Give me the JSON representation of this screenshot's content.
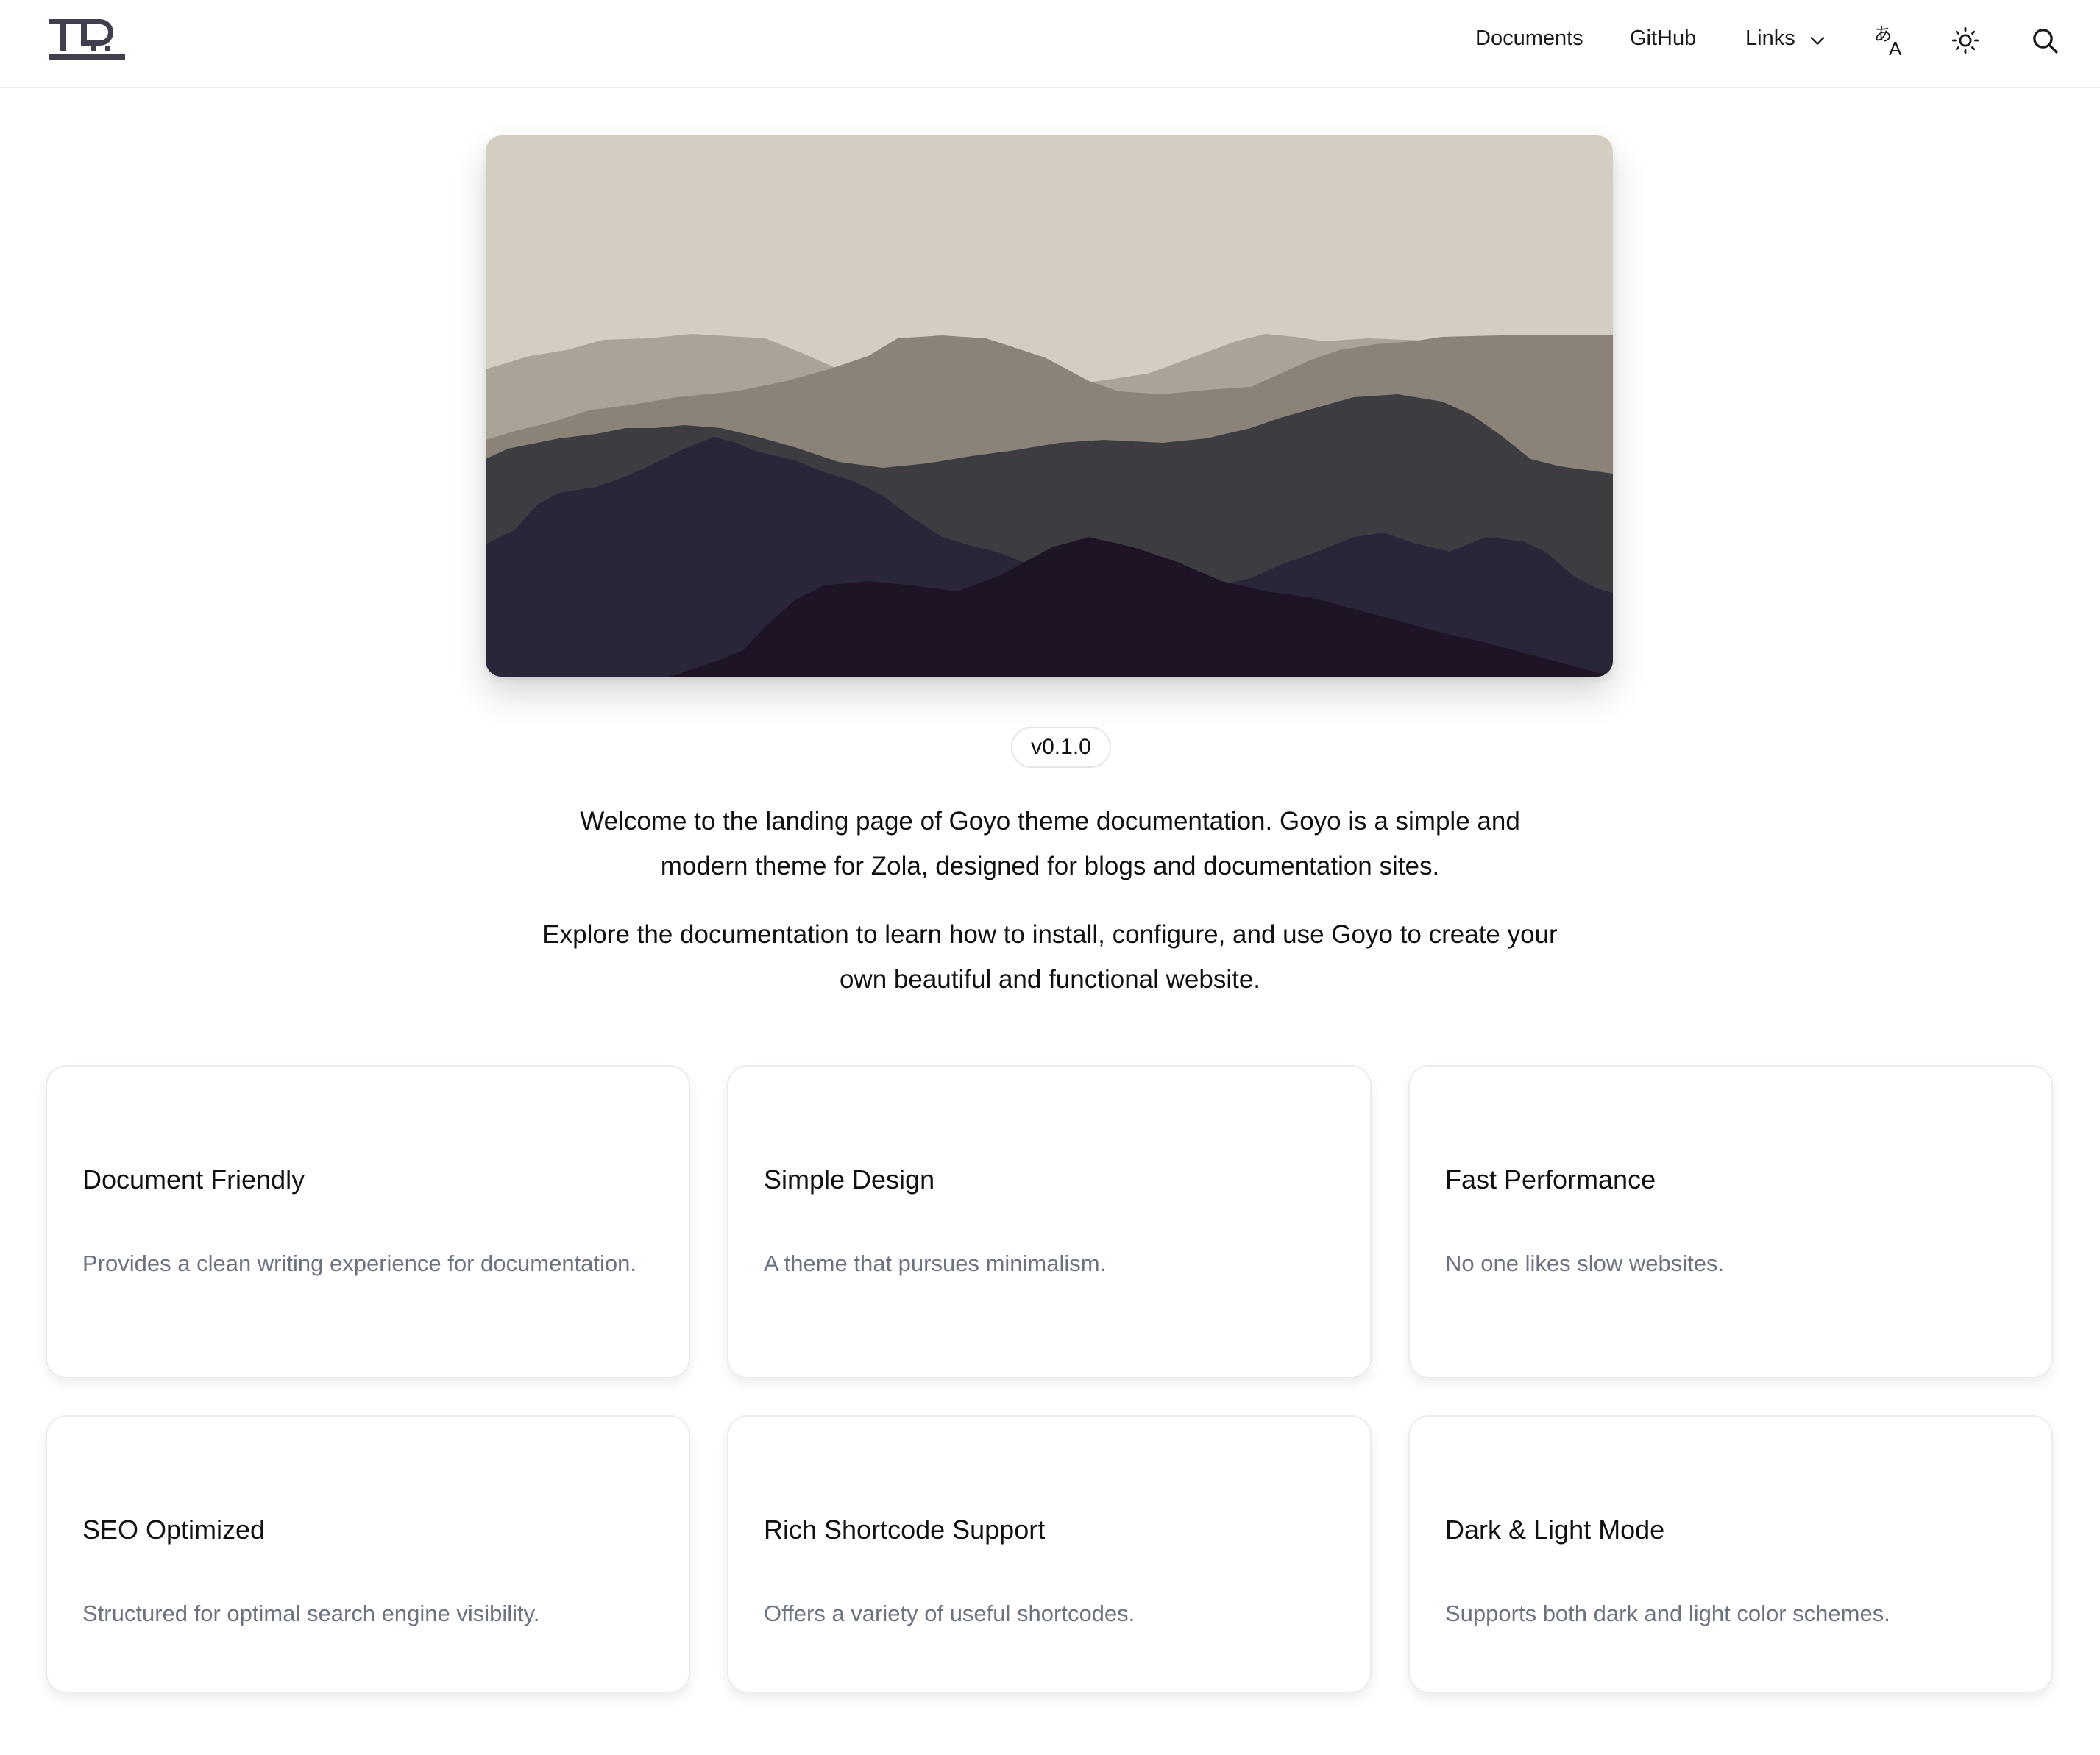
{
  "header": {
    "nav": {
      "documents": "Documents",
      "github": "GitHub",
      "links": "Links"
    },
    "icons": [
      "language-icon",
      "sun-icon",
      "search-icon"
    ]
  },
  "hero": {
    "image_alt": "Layered mountain silhouettes",
    "colors": {
      "sky": "#d3cdc2",
      "layer1": "#aaa398",
      "layer2": "#8b8378",
      "layer3": "#3d3d41",
      "layer4": "#29263a",
      "layer5": "#1f1425"
    }
  },
  "version": "v0.1.0",
  "intro": {
    "p1": "Welcome to the landing page of Goyo theme documentation. Goyo is a simple and modern theme for Zola, designed for blogs and documentation sites.",
    "p2": "Explore the documentation to learn how to install, configure, and use Goyo to create your own beautiful and functional website."
  },
  "features": [
    {
      "title": "Document Friendly",
      "desc": "Provides a clean writing experience for documentation."
    },
    {
      "title": "Simple Design",
      "desc": "A theme that pursues minimalism."
    },
    {
      "title": "Fast Performance",
      "desc": "No one likes slow websites."
    },
    {
      "title": "SEO Optimized",
      "desc": "Structured for optimal search engine visibility."
    },
    {
      "title": "Rich Shortcode Support",
      "desc": "Offers a variety of useful shortcodes."
    },
    {
      "title": "Dark & Light Mode",
      "desc": "Supports both dark and light color schemes."
    }
  ],
  "theme_colors": {
    "text": "#111111",
    "muted_text": "#6b7280",
    "border": "#ececec",
    "logo": "#3f3f4e"
  }
}
